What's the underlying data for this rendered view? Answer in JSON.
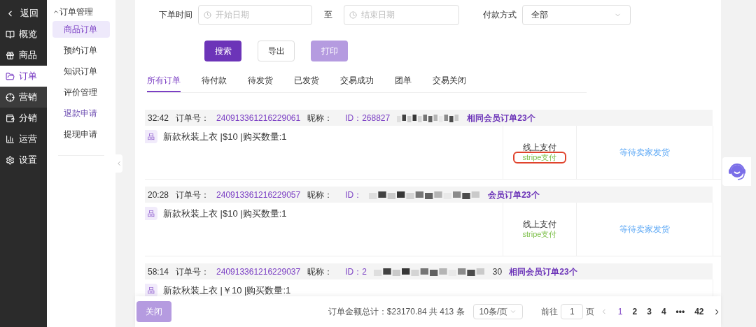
{
  "nav": {
    "back": "返回",
    "items": [
      {
        "kind": "overview",
        "label": "概览",
        "selected": false,
        "hovered": false
      },
      {
        "kind": "goods",
        "label": "商品",
        "selected": false,
        "hovered": false
      },
      {
        "kind": "orders",
        "label": "订单",
        "selected": true,
        "hovered": false
      },
      {
        "kind": "marketing",
        "label": "营销",
        "selected": false,
        "hovered": true
      },
      {
        "kind": "distribution",
        "label": "分销",
        "selected": false,
        "hovered": false
      },
      {
        "kind": "operations",
        "label": "运营",
        "selected": false,
        "hovered": false
      },
      {
        "kind": "settings",
        "label": "设置",
        "selected": false,
        "hovered": false
      }
    ]
  },
  "subnav": {
    "group": {
      "label": "订单管理",
      "expanded": true
    },
    "items": [
      {
        "label": "商品订单",
        "selected": true,
        "hovered": false
      },
      {
        "label": "预约订单",
        "selected": false,
        "hovered": false
      },
      {
        "label": "知识订单",
        "selected": false,
        "hovered": false
      },
      {
        "label": "评价管理",
        "selected": false,
        "hovered": false
      },
      {
        "label": "退款申请",
        "selected": false,
        "hovered": true
      },
      {
        "label": "提现申请",
        "selected": false,
        "hovered": false
      }
    ]
  },
  "filters": {
    "time_label": "下单时间",
    "start_placeholder": "开始日期",
    "to": "至",
    "end_placeholder": "结束日期",
    "payment_label": "付款方式",
    "payment_value": "全部"
  },
  "buttons": [
    {
      "kind": "primary",
      "label": "搜索",
      "disabled": false
    },
    {
      "kind": "plain",
      "label": "导出"
    },
    {
      "kind": "primary",
      "label": "打印",
      "disabled": true
    }
  ],
  "tabs": [
    {
      "label": "所有订单",
      "selected": true
    },
    {
      "label": "待付款",
      "selected": false
    },
    {
      "label": "待发货",
      "selected": false
    },
    {
      "label": "已发货",
      "selected": false
    },
    {
      "label": "交易成功",
      "selected": false
    },
    {
      "label": "团单",
      "selected": false
    },
    {
      "label": "交易关闭",
      "selected": false
    }
  ],
  "orders": [
    {
      "time": "32:42",
      "order_label": "订单号：",
      "order_no": "240913361216229061",
      "nick_label": "昵称：",
      "id_text": "ID：268827",
      "same_member": "相同会员订单23个",
      "tag": "品",
      "product": "新款秋装上衣 |$10 |购买数量:1",
      "pay": "线上支付",
      "pay_method": "stripe支付",
      "highlighted": true,
      "status": "等待卖家发货"
    },
    {
      "time": "20:28",
      "order_label": "订单号：",
      "order_no": "240913361216229057",
      "nick_label": "昵称：",
      "id_text": "ID：",
      "same_member": "会员订单23个",
      "tag": "品",
      "product": "新款秋装上衣 |$10 |购买数量:1",
      "pay": "线上支付",
      "pay_method": "stripe支付",
      "highlighted": false,
      "status": "等待卖家发货"
    },
    {
      "time": "58:14",
      "order_label": "订单号：",
      "order_no": "240913361216229037",
      "nick_label": "昵称：",
      "id_text": "ID：2",
      "id_tail": "30",
      "same_member": "相同会员订单23个",
      "tag": "品",
      "product": "新款秋装上衣 |￥10 |购买数量:1"
    }
  ],
  "footer": {
    "close": "关闭",
    "total": "订单金额总计：$23170.84 共 413 条",
    "page_size": "10条/页",
    "goto": "前往",
    "goto_value": "1",
    "page_unit": "页",
    "pages": [
      {
        "label": "1",
        "selected": true
      },
      {
        "label": "2",
        "selected": false
      },
      {
        "label": "3",
        "selected": false
      },
      {
        "label": "4",
        "selected": false
      },
      {
        "label": "•••",
        "selected": false
      },
      {
        "label": "42",
        "selected": false
      }
    ]
  }
}
